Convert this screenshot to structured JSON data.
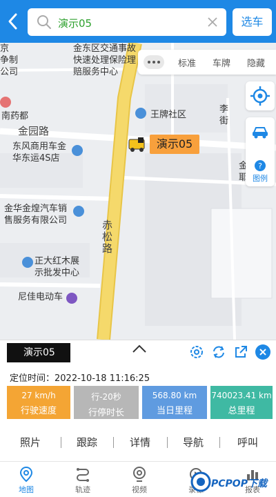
{
  "topbar": {
    "search_value": "演示05",
    "select_car_label": "选车"
  },
  "map": {
    "layer_options": [
      "标准",
      "车牌",
      "隐藏"
    ],
    "legend_label": "图例",
    "labels": {
      "poi_traffic": "金东区交通事故\n快速处理保险理\n赔服务中心",
      "poi_wangpai": "王牌社区",
      "street_liqi": "李\n街",
      "road_jinyi": "金园路",
      "poi_dongfeng": "东风商用车金\n华东运4S店",
      "poi_jinhuang": "金华金煌汽车销\n售服务有限公司",
      "road_chisong": "赤\n松\n路",
      "poi_zhengda": "正大红木展\n示批发中心",
      "poi_nijia": "尼佳电动车",
      "left_edge_1": "京\n争制\n公司",
      "left_edge_2": "南药都",
      "right_edge": "金\n耶"
    },
    "vehicle_tag": "演示05",
    "colors": {
      "road_main": "#f5d96b",
      "road_edge": "#e8c547",
      "tag_bg": "#f8a03c",
      "accent": "#1e88e5"
    }
  },
  "info": {
    "vehicle_name": "演示05",
    "location_time_label": "定位时间：",
    "location_time_value": "2022-10-18 11:16:25",
    "stats": [
      {
        "value": "27 km/h",
        "label": "行驶速度",
        "color": "#f4a534"
      },
      {
        "value": "行-20秒",
        "label": "行停时长",
        "color": "#b7b7b7"
      },
      {
        "value": "568.80 km",
        "label": "当日里程",
        "color": "#5f9be0"
      },
      {
        "value": "740023.41 km",
        "label": "总里程",
        "color": "#3fb9a3"
      }
    ],
    "actions": [
      "照片",
      "跟踪",
      "详情",
      "导航",
      "呼叫"
    ]
  },
  "bottom_nav": {
    "items": [
      "地图",
      "轨迹",
      "视频",
      "录像",
      "报表"
    ],
    "active": "地图",
    "watermark_text": "PCPOP下载"
  },
  "icons": {
    "back": "chevron-left-icon",
    "search": "search-icon",
    "clear": "close-icon",
    "more": "more-icon",
    "locate": "locate-icon",
    "car": "car-icon",
    "legend": "help-icon",
    "settings": "gear-icon",
    "refresh": "refresh-icon",
    "share": "share-icon",
    "close": "close-circle-icon"
  }
}
